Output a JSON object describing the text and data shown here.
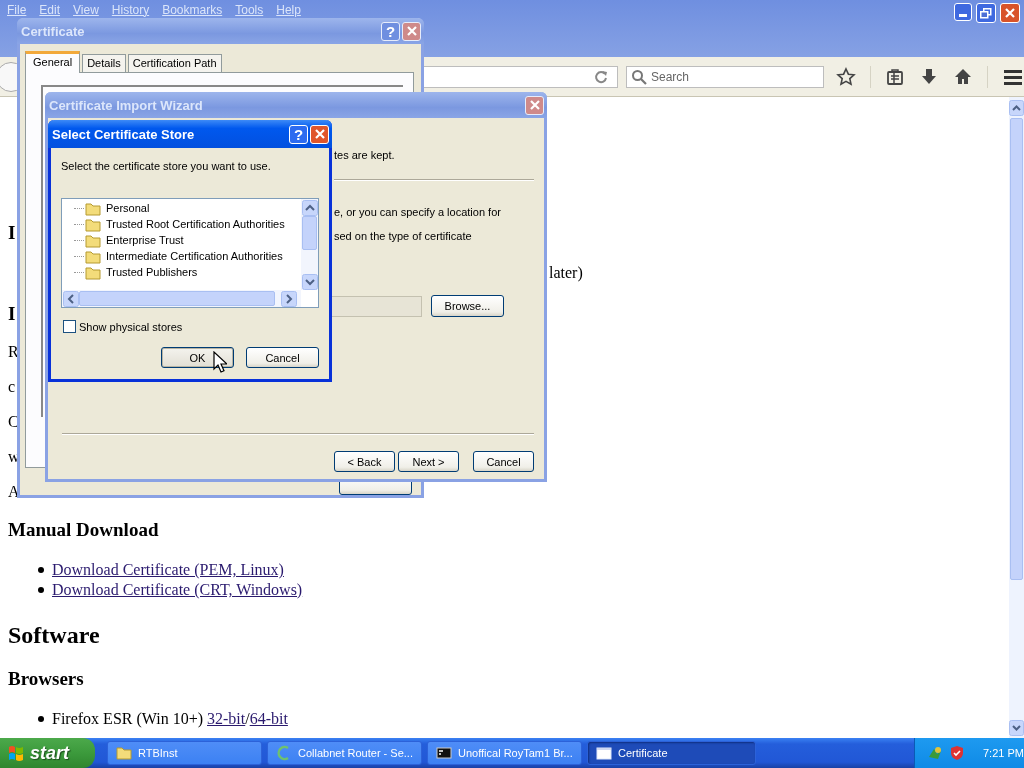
{
  "browser": {
    "menu": [
      "File",
      "Edit",
      "View",
      "History",
      "Bookmarks",
      "Tools",
      "Help"
    ],
    "search": {
      "placeholder": "Search"
    },
    "page": {
      "blocks": [
        {
          "kind": "h3",
          "text": "I"
        },
        {
          "kind": "tail",
          "text": "later)"
        },
        {
          "kind": "h3",
          "text": "I"
        },
        {
          "kind": "p",
          "text": "R"
        },
        {
          "kind": "p",
          "text": "c"
        },
        {
          "kind": "p",
          "text": "C"
        },
        {
          "kind": "p",
          "text": "w"
        },
        {
          "kind": "p",
          "text": "A"
        },
        {
          "kind": "h3",
          "text": "Manual Download"
        },
        {
          "kind": "li",
          "parts": [
            {
              "text": "Download Certificate (PEM, Linux)",
              "link": true
            }
          ]
        },
        {
          "kind": "li",
          "parts": [
            {
              "text": "Download Certificate (CRT, Windows)",
              "link": true
            }
          ]
        },
        {
          "kind": "h2",
          "text": "Software"
        },
        {
          "kind": "h3",
          "text": "Browsers"
        },
        {
          "kind": "li",
          "parts": [
            {
              "text": "Firefox ESR (Win 10+) ",
              "link": false
            },
            {
              "text": "32-bit",
              "link": true
            },
            {
              "text": "/",
              "link": false
            },
            {
              "text": "64-bit",
              "link": true
            }
          ]
        }
      ]
    }
  },
  "certificate_window": {
    "title": "Certificate",
    "help": "?",
    "tabs": [
      {
        "label": "General",
        "selected": true
      },
      {
        "label": "Details",
        "selected": false
      },
      {
        "label": "Certification Path",
        "selected": false
      }
    ]
  },
  "import_wizard": {
    "title": "Certificate Import Wizard",
    "fragments": [
      "tes are kept.",
      "e, or you can specify a location for",
      "sed on the type of certificate"
    ],
    "browse_button": "Browse...",
    "buttons": [
      "< Back",
      "Next >",
      "Cancel"
    ]
  },
  "store_dialog": {
    "title": "Select Certificate Store",
    "help": "?",
    "prompt": "Select the certificate store you want to use.",
    "stores": [
      "Personal",
      "Trusted Root Certification Authorities",
      "Enterprise Trust",
      "Intermediate Certification Authorities",
      "Trusted Publishers"
    ],
    "show_physical_stores": {
      "label": "Show physical stores",
      "checked": false
    },
    "buttons": [
      "OK",
      "Cancel"
    ]
  },
  "taskbar": {
    "start": "start",
    "tasks": [
      {
        "kind": "folder",
        "label": "RTBInst",
        "selected": false
      },
      {
        "kind": "router",
        "label": "Collabnet Router - Se...",
        "selected": false
      },
      {
        "kind": "console",
        "label": "Unoffical RoyTam1 Br...",
        "selected": false
      },
      {
        "kind": "window",
        "label": "Certificate",
        "selected": true
      }
    ],
    "clock": "7:21 PM"
  }
}
